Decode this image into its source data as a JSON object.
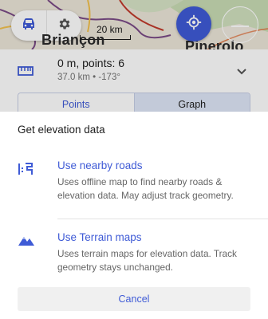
{
  "map": {
    "city_left": "Briançon",
    "city_right": "Pinerolo",
    "scale_label": "20 km",
    "icons": [
      "car-icon",
      "gear-icon",
      "my-location-icon",
      "zoom-out-icon"
    ]
  },
  "track": {
    "summary": "0 m, points: 6",
    "details": "37.0 km • -173°",
    "icons": [
      "ruler-icon",
      "chevron-down-icon"
    ]
  },
  "tabs": [
    {
      "label": "Points",
      "selected": true
    },
    {
      "label": "Graph",
      "selected": false
    }
  ],
  "sheet": {
    "title": "Get elevation data",
    "options": [
      {
        "label": "Use nearby roads",
        "description": "Uses offline map to find nearby roads & elevation data. May adjust track geometry.",
        "icon": "route-icon"
      },
      {
        "label": "Use Terrain maps",
        "description": "Uses terrain maps for elevation data. Track geometry stays unchanged.",
        "icon": "terrain-icon"
      }
    ],
    "cancel_label": "Cancel"
  },
  "colors": {
    "accent": "#3f5bd6",
    "text_primary": "#212121",
    "text_secondary": "#666666",
    "tab_selected_bg": "#dfe6f7"
  }
}
